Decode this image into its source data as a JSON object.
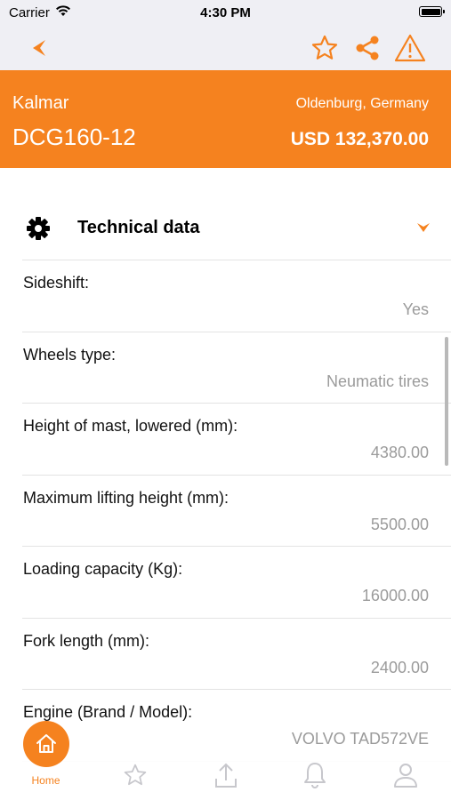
{
  "status_bar": {
    "carrier": "Carrier",
    "time": "4:30 PM"
  },
  "nav": {
    "icons": [
      "back-arrow-icon",
      "star-icon",
      "share-icon",
      "warning-icon"
    ],
    "accent_color": "#f5821f"
  },
  "listing": {
    "brand": "Kalmar",
    "model": "DCG160-12",
    "location": "Oldenburg, Germany",
    "price": "USD 132,370.00"
  },
  "section": {
    "title": "Technical data",
    "icon": "gear-icon",
    "toggle_icon": "chevron-down-icon"
  },
  "specs": [
    {
      "label": "Sideshift:",
      "value": "Yes"
    },
    {
      "label": "Wheels type:",
      "value": "Neumatic tires"
    },
    {
      "label": "Height of mast, lowered (mm):",
      "value": "4380.00"
    },
    {
      "label": "Maximum lifting height (mm):",
      "value": "5500.00"
    },
    {
      "label": "Loading capacity (Kg):",
      "value": "16000.00"
    },
    {
      "label": "Fork length (mm):",
      "value": "2400.00"
    },
    {
      "label": "Engine (Brand / Model):",
      "value": "VOLVO TAD572VE"
    }
  ],
  "tab_bar": {
    "home_label": "Home",
    "icons": [
      "home-icon",
      "star-icon",
      "upload-icon",
      "bell-icon",
      "user-icon"
    ]
  }
}
